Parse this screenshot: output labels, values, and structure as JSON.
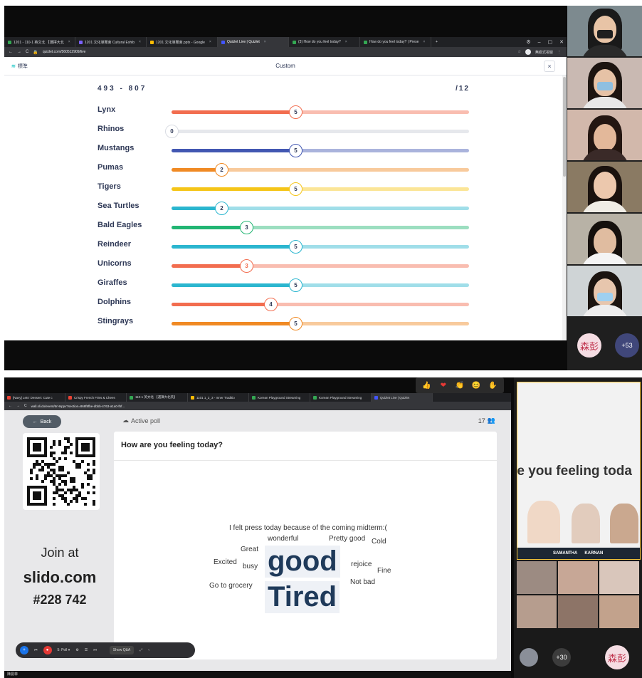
{
  "top": {
    "tabs": [
      {
        "label": "1201 - 110-1 英文北 【選擇大北",
        "color": "#34a853",
        "active": false
      },
      {
        "label": "1201 文化導覽會 Cultural Exhib",
        "color": "#7b61ff",
        "active": false
      },
      {
        "label": "1201 文化導覽會.pptx - Google",
        "color": "#fbbc04",
        "active": false
      },
      {
        "label": "Quizlet Live | Quizlet",
        "color": "#4255ff",
        "active": true
      },
      {
        "label": "(3) How do you feel today?",
        "color": "#34a853",
        "active": false
      },
      {
        "label": "How do you feel today? | Prese",
        "color": "#34a853",
        "active": false
      }
    ],
    "new_tab": "+",
    "url": "quizlet.com/560512909/live",
    "profile": "無痕式視窗",
    "quizlet": {
      "logo_mark": "≋",
      "logo_text": "標準",
      "title": "Custom",
      "close": "×",
      "score_range": "493 - 807",
      "score_total": "/12",
      "max_points": 12,
      "teams": [
        {
          "name": "Lynx",
          "score": 5,
          "color": "#f26d4f"
        },
        {
          "name": "Rhinos",
          "score": 0,
          "color": "#d9dce3"
        },
        {
          "name": "Mustangs",
          "score": 5,
          "color": "#4257b2"
        },
        {
          "name": "Pumas",
          "score": 2,
          "color": "#f08a24"
        },
        {
          "name": "Tigers",
          "score": 5,
          "color": "#f5c518"
        },
        {
          "name": "Sea Turtles",
          "score": 2,
          "color": "#2bb6cf"
        },
        {
          "name": "Bald Eagles",
          "score": 3,
          "color": "#22b573"
        },
        {
          "name": "Reindeer",
          "score": 5,
          "color": "#2bb6cf"
        },
        {
          "name": "Unicorns",
          "score": 3,
          "color": "#f26d4f"
        },
        {
          "name": "Giraffes",
          "score": 5,
          "color": "#2bb6cf"
        },
        {
          "name": "Dolphins",
          "score": 4,
          "color": "#f26d4f"
        },
        {
          "name": "Stingrays",
          "score": 5,
          "color": "#f08a24"
        }
      ]
    },
    "gallery": {
      "participant_initials": "森彭",
      "more_count": "+53"
    }
  },
  "bottom": {
    "reactions": [
      "👍",
      "❤",
      "👏",
      "😊",
      "✋"
    ],
    "tabs": [
      {
        "label": "[Navy] Lets' Dessert: Cute c",
        "color": "#ea4335"
      },
      {
        "label": "Crispy French Fries & Chees",
        "color": "#ea4335"
      },
      {
        "label": "110-1 英文北 【選擇大北英】",
        "color": "#34a853"
      },
      {
        "label": "1101 1_2_3 - Inner Traditio",
        "color": "#fbbc04"
      },
      {
        "label": "Korean Playground Streaming",
        "color": "#34a853"
      },
      {
        "label": "Korean Playground Streaming",
        "color": "#34a853"
      },
      {
        "label": "Quizlet Live | Quizlet",
        "color": "#4255ff"
      }
    ],
    "url": "wall.sli.do/event/6rHsppv?section=868f8fbe-dbbb-4763-a1a0-f5f...",
    "slido": {
      "back_label": "Back",
      "active_poll": "Active poll",
      "participants": "17",
      "join_at": "Join at",
      "site": "slido.com",
      "code": "#228 742",
      "question": "How are you feeling today?",
      "words": {
        "midterm": "I felt press today because of the coming midterm:(",
        "wonderful": "wonderful",
        "pretty_good": "Pretty good",
        "cold": "Cold",
        "great": "Great",
        "excited": "Excited",
        "busy": "busy",
        "good": "good",
        "rejoice": "rejoice",
        "fine": "Fine",
        "not_bad": "Not bad",
        "grocery": "Go to grocery",
        "tired": "Tired"
      },
      "toolbar": {
        "poll": "5: Poll ▾",
        "show_qa": "Show Q&A"
      }
    },
    "share_text": "re you feeling toda",
    "name_tags": [
      "SAMANTHA",
      "KARNAN"
    ],
    "more_count": "+30",
    "participant_initials": "森彭",
    "presenter_name": "陳曼菲"
  }
}
